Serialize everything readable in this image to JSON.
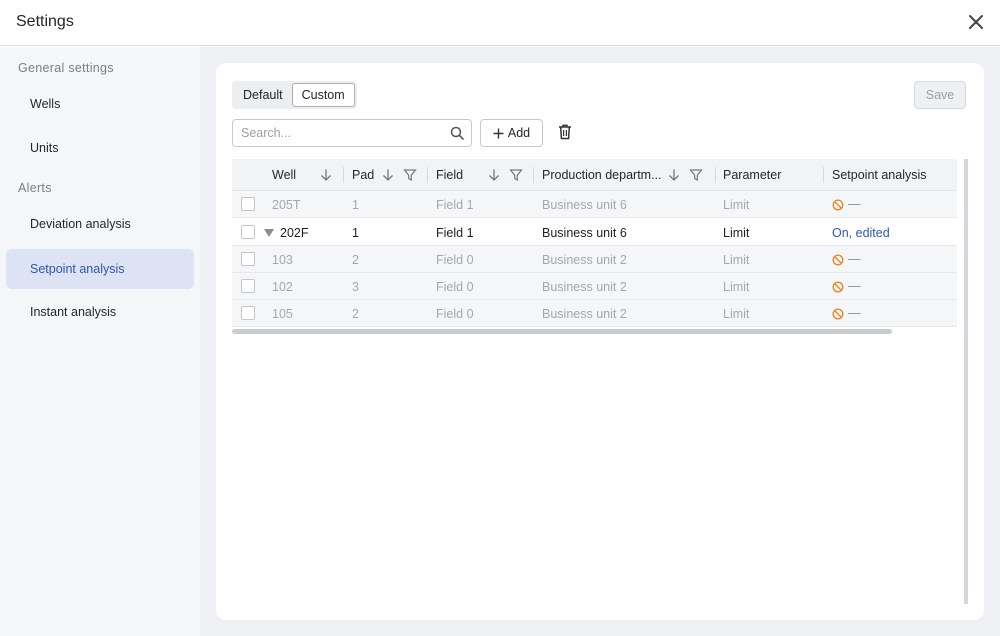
{
  "window": {
    "title": "Settings"
  },
  "sidebar": {
    "sections": [
      {
        "label": "General settings"
      },
      {
        "label": "Alerts"
      }
    ],
    "items": [
      {
        "label": "Wells"
      },
      {
        "label": "Units"
      },
      {
        "label": "Deviation analysis"
      },
      {
        "label": "Setpoint analysis",
        "active": true
      },
      {
        "label": "Instant analysis"
      }
    ]
  },
  "toolbar": {
    "segments": [
      "Default",
      "Custom"
    ],
    "selected_segment": "Custom",
    "save_label": "Save",
    "search_placeholder": "Search...",
    "add_label": "Add"
  },
  "table": {
    "columns": [
      "Well",
      "Pad",
      "Field",
      "Production departm...",
      "Parameter",
      "Setpoint analysis"
    ],
    "rows": [
      {
        "well": "205T",
        "pad": "1",
        "field": "Field 1",
        "department": "Business unit 6",
        "parameter": "Limit",
        "status": "—",
        "status_icon": "ban-icon",
        "dim": true
      },
      {
        "well": "202F",
        "pad": "1",
        "field": "Field 1",
        "department": "Business unit 6",
        "parameter": "Limit",
        "status": "On, edited",
        "expanded": true,
        "dim": false
      },
      {
        "well": "103",
        "pad": "2",
        "field": "Field 0",
        "department": "Business unit 2",
        "parameter": "Limit",
        "status": "—",
        "status_icon": "ban-icon",
        "dim": true
      },
      {
        "well": "102",
        "pad": "3",
        "field": "Field 0",
        "department": "Business unit 2",
        "parameter": "Limit",
        "status": "—",
        "status_icon": "ban-icon",
        "dim": true
      },
      {
        "well": "105",
        "pad": "2",
        "field": "Field 0",
        "department": "Business unit 2",
        "parameter": "Limit",
        "status": "—",
        "status_icon": "ban-icon",
        "dim": true
      }
    ]
  },
  "colors": {
    "accent": "#2f57b3",
    "active_item_bg": "#dde3f5",
    "disabled_icon": "#e8892b"
  }
}
